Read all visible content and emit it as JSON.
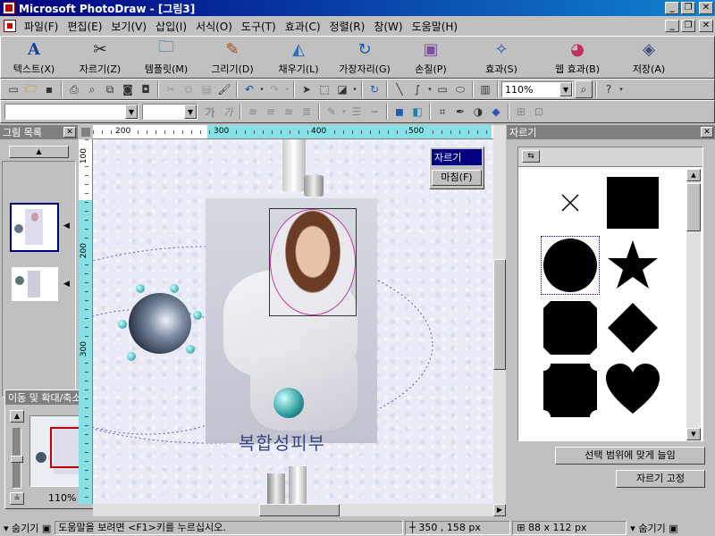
{
  "window": {
    "title": "Microsoft PhotoDraw - [그림3]"
  },
  "menu": [
    "파일(F)",
    "편집(E)",
    "보기(V)",
    "삽입(I)",
    "서식(O)",
    "도구(T)",
    "효과(C)",
    "정렬(R)",
    "창(W)",
    "도움말(H)"
  ],
  "bigToolbar": [
    {
      "label": "텍스트(X)",
      "icon": "text-icon"
    },
    {
      "label": "자르기(Z)",
      "icon": "scissors-icon"
    },
    {
      "label": "템플릿(M)",
      "icon": "template-icon"
    },
    {
      "label": "그리기(D)",
      "icon": "draw-icon"
    },
    {
      "label": "채우기(L)",
      "icon": "fill-icon"
    },
    {
      "label": "가장자리(G)",
      "icon": "edge-icon"
    },
    {
      "label": "손질(P)",
      "icon": "touchup-icon"
    },
    {
      "label": "효과(S)",
      "icon": "effects-icon"
    },
    {
      "label": "웹 효과(B)",
      "icon": "web-effects-icon"
    },
    {
      "label": "저장(A)",
      "icon": "save-icon"
    }
  ],
  "zoom": {
    "value": "110%"
  },
  "leftPanel": {
    "title": "그림 목록"
  },
  "navPanel": {
    "title": "이동 및 확대/축소",
    "zoom": "110%"
  },
  "ruler": {
    "h": [
      "200",
      "300",
      "400",
      "500"
    ],
    "v": [
      "100",
      "200",
      "300"
    ]
  },
  "cutMenu": {
    "items": [
      "자르기",
      "마침(F)"
    ]
  },
  "canvasText": "복합성피부",
  "rightPanel": {
    "title": "자르기",
    "shapes": [
      "x-shape",
      "square-shape",
      "circle-shape",
      "star-shape",
      "octagon-shape",
      "diamond-shape",
      "notched-square-shape",
      "heart-shape"
    ],
    "buttons": [
      "선택 범위에 맞게 늘임",
      "자르기 고정"
    ]
  },
  "status": {
    "hide": "숨기기",
    "help": "도움말을 보려면 <F1>키를 누르십시오.",
    "coords": "350 , 158  px",
    "size": "88 x 112  px",
    "hideRight": "숨기기"
  }
}
